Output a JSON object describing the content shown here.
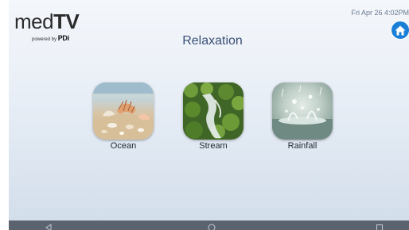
{
  "logo": {
    "main_light": "med",
    "main_bold": "TV",
    "powered_by": "powered by",
    "brand": "PDi"
  },
  "header": {
    "title": "Relaxation",
    "datetime": "Fri Apr 26  4:02PM",
    "home_icon": "home-icon"
  },
  "tiles": [
    {
      "label": "Ocean",
      "image": "ocean-shells-image"
    },
    {
      "label": "Stream",
      "image": "mossy-stream-image"
    },
    {
      "label": "Rainfall",
      "image": "rain-droplets-image"
    }
  ],
  "nav_bar": {
    "back_icon": "back-triangle-icon",
    "home_icon": "home-circle-icon",
    "recents_icon": "recents-square-icon"
  },
  "colors": {
    "title": "#3a4f75",
    "home_button": "#1a7fd6",
    "nav_bar": "#5a636e"
  }
}
